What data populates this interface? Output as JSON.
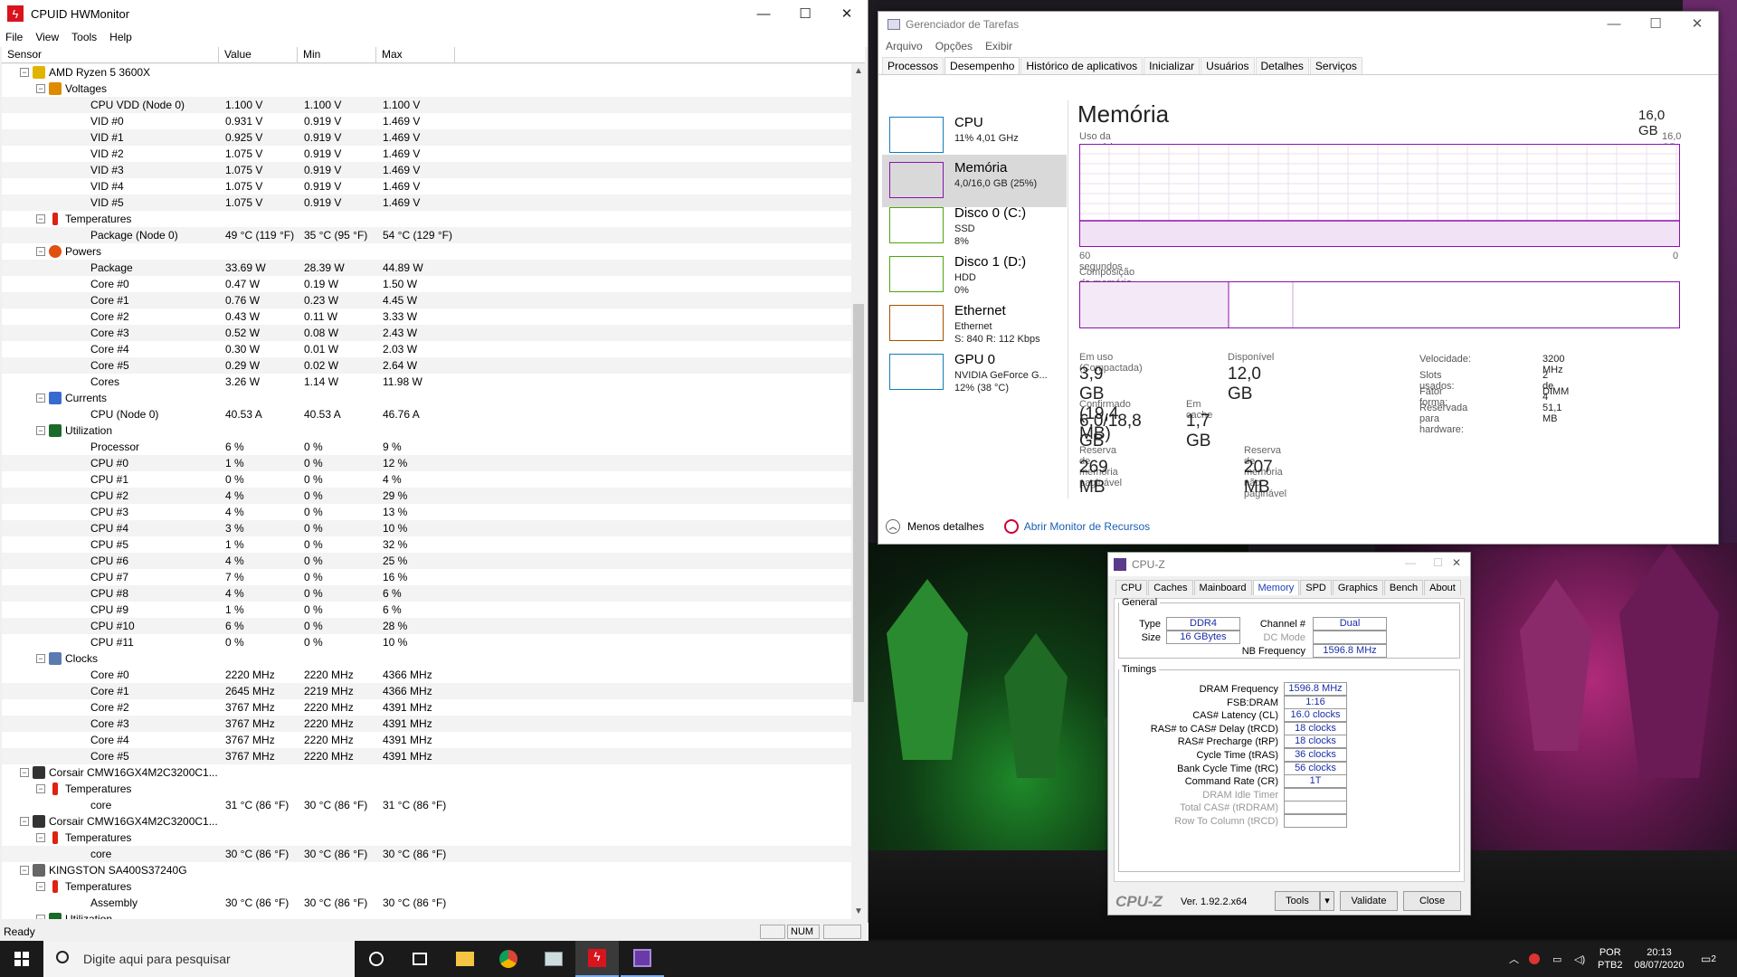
{
  "hwmonitor": {
    "title": "CPUID HWMonitor",
    "menu": [
      "File",
      "View",
      "Tools",
      "Help"
    ],
    "columns": [
      "Sensor",
      "Value",
      "Min",
      "Max"
    ],
    "status": "Ready",
    "num": "NUM",
    "rows": [
      {
        "level": 1,
        "label": "AMD Ryzen 5 3600X",
        "icon": "chip-icon",
        "tog": "−"
      },
      {
        "level": 2,
        "label": "Voltages",
        "icon": "voltage-icon",
        "tog": "−"
      },
      {
        "level": 3,
        "label": "CPU VDD (Node 0)",
        "v": "1.100 V",
        "mn": "1.100 V",
        "mx": "1.100 V"
      },
      {
        "level": 3,
        "label": "VID #0",
        "v": "0.931 V",
        "mn": "0.919 V",
        "mx": "1.469 V"
      },
      {
        "level": 3,
        "label": "VID #1",
        "v": "0.925 V",
        "mn": "0.919 V",
        "mx": "1.469 V"
      },
      {
        "level": 3,
        "label": "VID #2",
        "v": "1.075 V",
        "mn": "0.919 V",
        "mx": "1.469 V"
      },
      {
        "level": 3,
        "label": "VID #3",
        "v": "1.075 V",
        "mn": "0.919 V",
        "mx": "1.469 V"
      },
      {
        "level": 3,
        "label": "VID #4",
        "v": "1.075 V",
        "mn": "0.919 V",
        "mx": "1.469 V"
      },
      {
        "level": 3,
        "label": "VID #5",
        "v": "1.075 V",
        "mn": "0.919 V",
        "mx": "1.469 V"
      },
      {
        "level": 2,
        "label": "Temperatures",
        "icon": "thermometer-icon",
        "tog": "−"
      },
      {
        "level": 3,
        "label": "Package (Node 0)",
        "v": "49 °C  (119 °F)",
        "mn": "35 °C  (95 °F)",
        "mx": "54 °C  (129 °F)"
      },
      {
        "level": 2,
        "label": "Powers",
        "icon": "power-icon",
        "tog": "−"
      },
      {
        "level": 3,
        "label": "Package",
        "v": "33.69 W",
        "mn": "28.39 W",
        "mx": "44.89 W"
      },
      {
        "level": 3,
        "label": "Core #0",
        "v": "0.47 W",
        "mn": "0.19 W",
        "mx": "1.50 W"
      },
      {
        "level": 3,
        "label": "Core #1",
        "v": "0.76 W",
        "mn": "0.23 W",
        "mx": "4.45 W"
      },
      {
        "level": 3,
        "label": "Core #2",
        "v": "0.43 W",
        "mn": "0.11 W",
        "mx": "3.33 W"
      },
      {
        "level": 3,
        "label": "Core #3",
        "v": "0.52 W",
        "mn": "0.08 W",
        "mx": "2.43 W"
      },
      {
        "level": 3,
        "label": "Core #4",
        "v": "0.30 W",
        "mn": "0.01 W",
        "mx": "2.03 W"
      },
      {
        "level": 3,
        "label": "Core #5",
        "v": "0.29 W",
        "mn": "0.02 W",
        "mx": "2.64 W"
      },
      {
        "level": 3,
        "label": "Cores",
        "v": "3.26 W",
        "mn": "1.14 W",
        "mx": "11.98 W"
      },
      {
        "level": 2,
        "label": "Currents",
        "icon": "current-icon",
        "tog": "−"
      },
      {
        "level": 3,
        "label": "CPU (Node 0)",
        "v": "40.53 A",
        "mn": "40.53 A",
        "mx": "46.76 A"
      },
      {
        "level": 2,
        "label": "Utilization",
        "icon": "utilization-icon",
        "tog": "−"
      },
      {
        "level": 3,
        "label": "Processor",
        "v": "6 %",
        "mn": "0 %",
        "mx": "9 %"
      },
      {
        "level": 3,
        "label": "CPU #0",
        "v": "1 %",
        "mn": "0 %",
        "mx": "12 %"
      },
      {
        "level": 3,
        "label": "CPU #1",
        "v": "0 %",
        "mn": "0 %",
        "mx": "4 %"
      },
      {
        "level": 3,
        "label": "CPU #2",
        "v": "4 %",
        "mn": "0 %",
        "mx": "29 %"
      },
      {
        "level": 3,
        "label": "CPU #3",
        "v": "4 %",
        "mn": "0 %",
        "mx": "13 %"
      },
      {
        "level": 3,
        "label": "CPU #4",
        "v": "3 %",
        "mn": "0 %",
        "mx": "10 %"
      },
      {
        "level": 3,
        "label": "CPU #5",
        "v": "1 %",
        "mn": "0 %",
        "mx": "32 %"
      },
      {
        "level": 3,
        "label": "CPU #6",
        "v": "4 %",
        "mn": "0 %",
        "mx": "25 %"
      },
      {
        "level": 3,
        "label": "CPU #7",
        "v": "7 %",
        "mn": "0 %",
        "mx": "16 %"
      },
      {
        "level": 3,
        "label": "CPU #8",
        "v": "4 %",
        "mn": "0 %",
        "mx": "6 %"
      },
      {
        "level": 3,
        "label": "CPU #9",
        "v": "1 %",
        "mn": "0 %",
        "mx": "6 %"
      },
      {
        "level": 3,
        "label": "CPU #10",
        "v": "6 %",
        "mn": "0 %",
        "mx": "28 %"
      },
      {
        "level": 3,
        "label": "CPU #11",
        "v": "0 %",
        "mn": "0 %",
        "mx": "10 %"
      },
      {
        "level": 2,
        "label": "Clocks",
        "icon": "clock-icon",
        "tog": "−"
      },
      {
        "level": 3,
        "label": "Core #0",
        "v": "2220 MHz",
        "mn": "2220 MHz",
        "mx": "4366 MHz"
      },
      {
        "level": 3,
        "label": "Core #1",
        "v": "2645 MHz",
        "mn": "2219 MHz",
        "mx": "4366 MHz"
      },
      {
        "level": 3,
        "label": "Core #2",
        "v": "3767 MHz",
        "mn": "2220 MHz",
        "mx": "4391 MHz"
      },
      {
        "level": 3,
        "label": "Core #3",
        "v": "3767 MHz",
        "mn": "2220 MHz",
        "mx": "4391 MHz"
      },
      {
        "level": 3,
        "label": "Core #4",
        "v": "3767 MHz",
        "mn": "2220 MHz",
        "mx": "4391 MHz"
      },
      {
        "level": 3,
        "label": "Core #5",
        "v": "3767 MHz",
        "mn": "2220 MHz",
        "mx": "4391 MHz"
      },
      {
        "level": 1,
        "label": "Corsair CMW16GX4M2C3200C1...",
        "icon": "ram-icon",
        "tog": "−"
      },
      {
        "level": 2,
        "label": "Temperatures",
        "icon": "thermometer-icon",
        "tog": "−"
      },
      {
        "level": 3,
        "label": "core",
        "v": "31 °C  (86 °F)",
        "mn": "30 °C  (86 °F)",
        "mx": "31 °C  (86 °F)"
      },
      {
        "level": 1,
        "label": "Corsair CMW16GX4M2C3200C1...",
        "icon": "ram-icon",
        "tog": "−"
      },
      {
        "level": 2,
        "label": "Temperatures",
        "icon": "thermometer-icon",
        "tog": "−"
      },
      {
        "level": 3,
        "label": "core",
        "v": "30 °C  (86 °F)",
        "mn": "30 °C  (86 °F)",
        "mx": "30 °C  (86 °F)"
      },
      {
        "level": 1,
        "label": "KINGSTON SA400S37240G",
        "icon": "disk-icon",
        "tog": "−"
      },
      {
        "level": 2,
        "label": "Temperatures",
        "icon": "thermometer-icon",
        "tog": "−"
      },
      {
        "level": 3,
        "label": "Assembly",
        "v": "30 °C  (86 °F)",
        "mn": "30 °C  (86 °F)",
        "mx": "30 °C  (86 °F)"
      },
      {
        "level": 2,
        "label": "Utilization",
        "icon": "utilization-icon",
        "tog": "−"
      }
    ]
  },
  "taskmgr": {
    "title": "Gerenciador de Tarefas",
    "menu": [
      "Arquivo",
      "Opções",
      "Exibir"
    ],
    "tabs": [
      "Processos",
      "Desempenho",
      "Histórico de aplicativos",
      "Inicializar",
      "Usuários",
      "Detalhes",
      "Serviços"
    ],
    "active_tab": "Desempenho",
    "items": [
      {
        "name": "CPU",
        "s1": "11% 4,01 GHz",
        "s2": "",
        "color": "#117dbb"
      },
      {
        "name": "Memória",
        "s1": "4,0/16,0 GB (25%)",
        "s2": "",
        "color": "#8b12ae"
      },
      {
        "name": "Disco 0 (C:)",
        "s1": "SSD",
        "s2": "8%",
        "color": "#4da60c"
      },
      {
        "name": "Disco 1 (D:)",
        "s1": "HDD",
        "s2": "0%",
        "color": "#4da60c"
      },
      {
        "name": "Ethernet",
        "s1": "Ethernet",
        "s2": "S: 840  R: 112 Kbps",
        "color": "#a74f01"
      },
      {
        "name": "GPU 0",
        "s1": "NVIDIA GeForce G...",
        "s2": "12% (38 °C)",
        "color": "#117dbb"
      }
    ],
    "heading": "Memória",
    "total": "16,0 GB",
    "usage_label": "Uso da memória",
    "usage_max": "16,0 GB",
    "seconds": "60 segundos",
    "zero": "0",
    "composition": "Composição da memória",
    "in_use_label": "Em uso (Compactada)",
    "in_use": "3,9 GB (19,4 MB)",
    "available_label": "Disponível",
    "available": "12,0 GB",
    "committed_label": "Confirmado",
    "committed": "6,0/18,8 GB",
    "cached_label": "Em cache",
    "cached": "1,7 GB",
    "paged_label": "Reserva de memória paginável",
    "paged": "269 MB",
    "nonpaged_label": "Reserva de memória não paginável",
    "nonpaged": "207 MB",
    "speed_label": "Velocidade:",
    "speed": "3200 MHz",
    "slots_label": "Slots usados:",
    "slots": "2 de 4",
    "form_label": "Fator forma:",
    "form": "DIMM",
    "reserved_label": "Reservada para hardware:",
    "reserved": "51,1 MB",
    "less_details": "Menos detalhes",
    "resmon": "Abrir Monitor de Recursos",
    "usage_fraction": 0.25
  },
  "cpuz": {
    "title": "CPU-Z",
    "tabs": [
      "CPU",
      "Caches",
      "Mainboard",
      "Memory",
      "SPD",
      "Graphics",
      "Bench",
      "About"
    ],
    "active_tab": "Memory",
    "general": "General",
    "type_label": "Type",
    "type": "DDR4",
    "size_label": "Size",
    "size": "16 GBytes",
    "channel_label": "Channel #",
    "channel": "Dual",
    "dcmode_label": "DC Mode",
    "nbfreq_label": "NB Frequency",
    "nbfreq": "1596.8 MHz",
    "timings": "Timings",
    "t": [
      {
        "label": "DRAM Frequency",
        "value": "1596.8 MHz"
      },
      {
        "label": "FSB:DRAM",
        "value": "1:16"
      },
      {
        "label": "CAS# Latency (CL)",
        "value": "16.0 clocks"
      },
      {
        "label": "RAS# to CAS# Delay (tRCD)",
        "value": "18 clocks"
      },
      {
        "label": "RAS# Precharge (tRP)",
        "value": "18 clocks"
      },
      {
        "label": "Cycle Time (tRAS)",
        "value": "36 clocks"
      },
      {
        "label": "Bank Cycle Time (tRC)",
        "value": "56 clocks"
      },
      {
        "label": "Command Rate (CR)",
        "value": "1T"
      },
      {
        "label": "DRAM Idle Timer",
        "value": ""
      },
      {
        "label": "Total CAS# (tRDRAM)",
        "value": ""
      },
      {
        "label": "Row To Column (tRCD)",
        "value": ""
      }
    ],
    "logo": "CPU-Z",
    "version": "Ver. 1.92.2.x64",
    "tools": "Tools",
    "validate": "Validate",
    "close": "Close"
  },
  "taskbar": {
    "search_placeholder": "Digite aqui para pesquisar",
    "lang1": "POR",
    "lang2": "PTB2",
    "time": "20:13",
    "date": "08/07/2020",
    "notif": "2"
  }
}
